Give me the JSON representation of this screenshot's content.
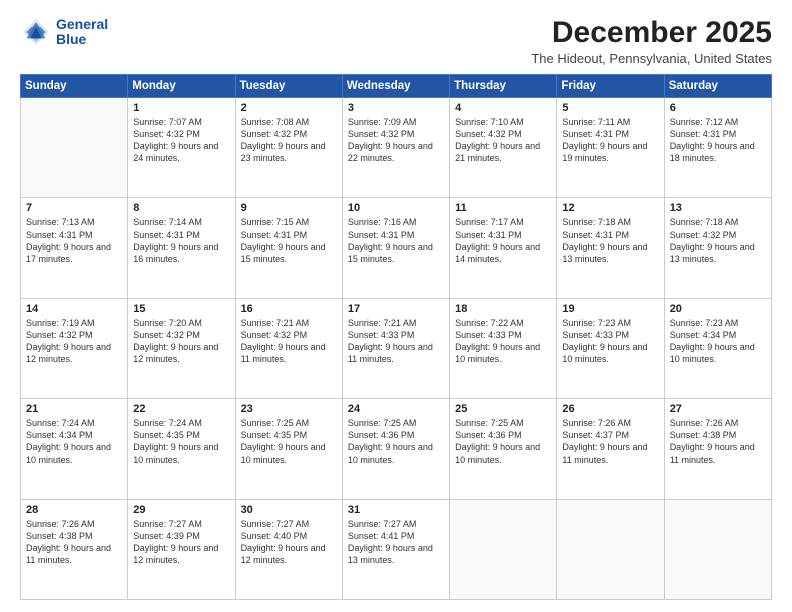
{
  "logo": {
    "line1": "General",
    "line2": "Blue"
  },
  "title": "December 2025",
  "location": "The Hideout, Pennsylvania, United States",
  "weekdays": [
    "Sunday",
    "Monday",
    "Tuesday",
    "Wednesday",
    "Thursday",
    "Friday",
    "Saturday"
  ],
  "weeks": [
    [
      {
        "day": "",
        "sunrise": "",
        "sunset": "",
        "daylight": ""
      },
      {
        "day": "1",
        "sunrise": "Sunrise: 7:07 AM",
        "sunset": "Sunset: 4:32 PM",
        "daylight": "Daylight: 9 hours and 24 minutes."
      },
      {
        "day": "2",
        "sunrise": "Sunrise: 7:08 AM",
        "sunset": "Sunset: 4:32 PM",
        "daylight": "Daylight: 9 hours and 23 minutes."
      },
      {
        "day": "3",
        "sunrise": "Sunrise: 7:09 AM",
        "sunset": "Sunset: 4:32 PM",
        "daylight": "Daylight: 9 hours and 22 minutes."
      },
      {
        "day": "4",
        "sunrise": "Sunrise: 7:10 AM",
        "sunset": "Sunset: 4:32 PM",
        "daylight": "Daylight: 9 hours and 21 minutes."
      },
      {
        "day": "5",
        "sunrise": "Sunrise: 7:11 AM",
        "sunset": "Sunset: 4:31 PM",
        "daylight": "Daylight: 9 hours and 19 minutes."
      },
      {
        "day": "6",
        "sunrise": "Sunrise: 7:12 AM",
        "sunset": "Sunset: 4:31 PM",
        "daylight": "Daylight: 9 hours and 18 minutes."
      }
    ],
    [
      {
        "day": "7",
        "sunrise": "Sunrise: 7:13 AM",
        "sunset": "Sunset: 4:31 PM",
        "daylight": "Daylight: 9 hours and 17 minutes."
      },
      {
        "day": "8",
        "sunrise": "Sunrise: 7:14 AM",
        "sunset": "Sunset: 4:31 PM",
        "daylight": "Daylight: 9 hours and 16 minutes."
      },
      {
        "day": "9",
        "sunrise": "Sunrise: 7:15 AM",
        "sunset": "Sunset: 4:31 PM",
        "daylight": "Daylight: 9 hours and 15 minutes."
      },
      {
        "day": "10",
        "sunrise": "Sunrise: 7:16 AM",
        "sunset": "Sunset: 4:31 PM",
        "daylight": "Daylight: 9 hours and 15 minutes."
      },
      {
        "day": "11",
        "sunrise": "Sunrise: 7:17 AM",
        "sunset": "Sunset: 4:31 PM",
        "daylight": "Daylight: 9 hours and 14 minutes."
      },
      {
        "day": "12",
        "sunrise": "Sunrise: 7:18 AM",
        "sunset": "Sunset: 4:31 PM",
        "daylight": "Daylight: 9 hours and 13 minutes."
      },
      {
        "day": "13",
        "sunrise": "Sunrise: 7:18 AM",
        "sunset": "Sunset: 4:32 PM",
        "daylight": "Daylight: 9 hours and 13 minutes."
      }
    ],
    [
      {
        "day": "14",
        "sunrise": "Sunrise: 7:19 AM",
        "sunset": "Sunset: 4:32 PM",
        "daylight": "Daylight: 9 hours and 12 minutes."
      },
      {
        "day": "15",
        "sunrise": "Sunrise: 7:20 AM",
        "sunset": "Sunset: 4:32 PM",
        "daylight": "Daylight: 9 hours and 12 minutes."
      },
      {
        "day": "16",
        "sunrise": "Sunrise: 7:21 AM",
        "sunset": "Sunset: 4:32 PM",
        "daylight": "Daylight: 9 hours and 11 minutes."
      },
      {
        "day": "17",
        "sunrise": "Sunrise: 7:21 AM",
        "sunset": "Sunset: 4:33 PM",
        "daylight": "Daylight: 9 hours and 11 minutes."
      },
      {
        "day": "18",
        "sunrise": "Sunrise: 7:22 AM",
        "sunset": "Sunset: 4:33 PM",
        "daylight": "Daylight: 9 hours and 10 minutes."
      },
      {
        "day": "19",
        "sunrise": "Sunrise: 7:23 AM",
        "sunset": "Sunset: 4:33 PM",
        "daylight": "Daylight: 9 hours and 10 minutes."
      },
      {
        "day": "20",
        "sunrise": "Sunrise: 7:23 AM",
        "sunset": "Sunset: 4:34 PM",
        "daylight": "Daylight: 9 hours and 10 minutes."
      }
    ],
    [
      {
        "day": "21",
        "sunrise": "Sunrise: 7:24 AM",
        "sunset": "Sunset: 4:34 PM",
        "daylight": "Daylight: 9 hours and 10 minutes."
      },
      {
        "day": "22",
        "sunrise": "Sunrise: 7:24 AM",
        "sunset": "Sunset: 4:35 PM",
        "daylight": "Daylight: 9 hours and 10 minutes."
      },
      {
        "day": "23",
        "sunrise": "Sunrise: 7:25 AM",
        "sunset": "Sunset: 4:35 PM",
        "daylight": "Daylight: 9 hours and 10 minutes."
      },
      {
        "day": "24",
        "sunrise": "Sunrise: 7:25 AM",
        "sunset": "Sunset: 4:36 PM",
        "daylight": "Daylight: 9 hours and 10 minutes."
      },
      {
        "day": "25",
        "sunrise": "Sunrise: 7:25 AM",
        "sunset": "Sunset: 4:36 PM",
        "daylight": "Daylight: 9 hours and 10 minutes."
      },
      {
        "day": "26",
        "sunrise": "Sunrise: 7:26 AM",
        "sunset": "Sunset: 4:37 PM",
        "daylight": "Daylight: 9 hours and 11 minutes."
      },
      {
        "day": "27",
        "sunrise": "Sunrise: 7:26 AM",
        "sunset": "Sunset: 4:38 PM",
        "daylight": "Daylight: 9 hours and 11 minutes."
      }
    ],
    [
      {
        "day": "28",
        "sunrise": "Sunrise: 7:26 AM",
        "sunset": "Sunset: 4:38 PM",
        "daylight": "Daylight: 9 hours and 11 minutes."
      },
      {
        "day": "29",
        "sunrise": "Sunrise: 7:27 AM",
        "sunset": "Sunset: 4:39 PM",
        "daylight": "Daylight: 9 hours and 12 minutes."
      },
      {
        "day": "30",
        "sunrise": "Sunrise: 7:27 AM",
        "sunset": "Sunset: 4:40 PM",
        "daylight": "Daylight: 9 hours and 12 minutes."
      },
      {
        "day": "31",
        "sunrise": "Sunrise: 7:27 AM",
        "sunset": "Sunset: 4:41 PM",
        "daylight": "Daylight: 9 hours and 13 minutes."
      },
      {
        "day": "",
        "sunrise": "",
        "sunset": "",
        "daylight": ""
      },
      {
        "day": "",
        "sunrise": "",
        "sunset": "",
        "daylight": ""
      },
      {
        "day": "",
        "sunrise": "",
        "sunset": "",
        "daylight": ""
      }
    ]
  ]
}
